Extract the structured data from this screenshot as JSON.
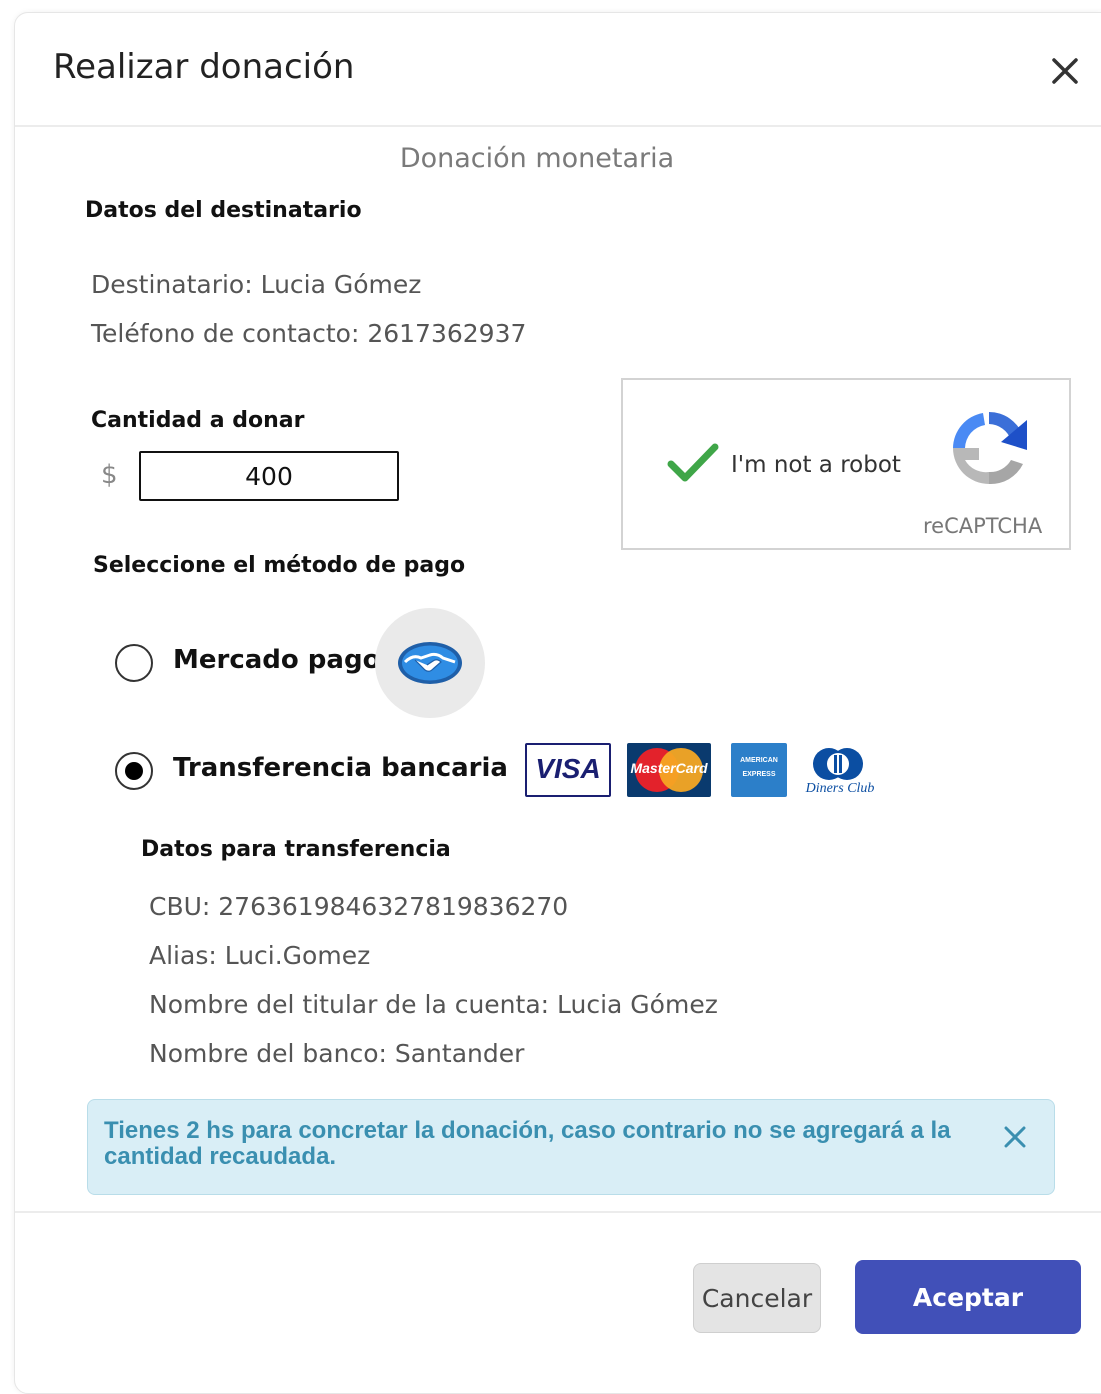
{
  "dialog": {
    "title": "Realizar donación",
    "subtitle": "Donación monetaria"
  },
  "recipient": {
    "heading": "Datos del destinatario",
    "name_line": "Destinatario: Lucia Gómez",
    "phone_line": "Teléfono de contacto: 2617362937"
  },
  "amount": {
    "heading": "Cantidad a donar",
    "currency": "$",
    "value": "400"
  },
  "captcha": {
    "label": "I'm not a robot",
    "brand": "reCAPTCHA",
    "checked": true
  },
  "payment": {
    "heading": "Seleccione el método de pago",
    "options": [
      {
        "label": "Mercado pago",
        "selected": false,
        "icon": "mercado-pago-handshake-icon"
      },
      {
        "label": "Transferencia bancaria",
        "selected": true,
        "icons": [
          "visa-logo",
          "mastercard-logo",
          "american-express-logo",
          "diners-club-logo"
        ]
      }
    ],
    "card_logos": {
      "visa": "VISA",
      "mastercard": "MasterCard",
      "amex_line1": "AMERICAN",
      "amex_line2": "EXPRESS",
      "diners": "Diners Club"
    }
  },
  "transfer": {
    "heading": "Datos para transferencia",
    "cbu": "CBU: 2763619846327819836270",
    "alias": "Alias: Luci.Gomez",
    "holder": "Nombre del titular de la cuenta: Lucia Gómez",
    "bank": "Nombre del banco: Santander"
  },
  "alert": {
    "text": "Tienes 2 hs para concretar la donación, caso contrario no se agregará a la cantidad recaudada."
  },
  "footer": {
    "cancel_label": "Cancelar",
    "accept_label": "Aceptar"
  },
  "colors": {
    "accent": "#4150b8",
    "alert_bg": "#d9eef6",
    "alert_text": "#3a8fb0",
    "check_green": "#3fa648"
  }
}
